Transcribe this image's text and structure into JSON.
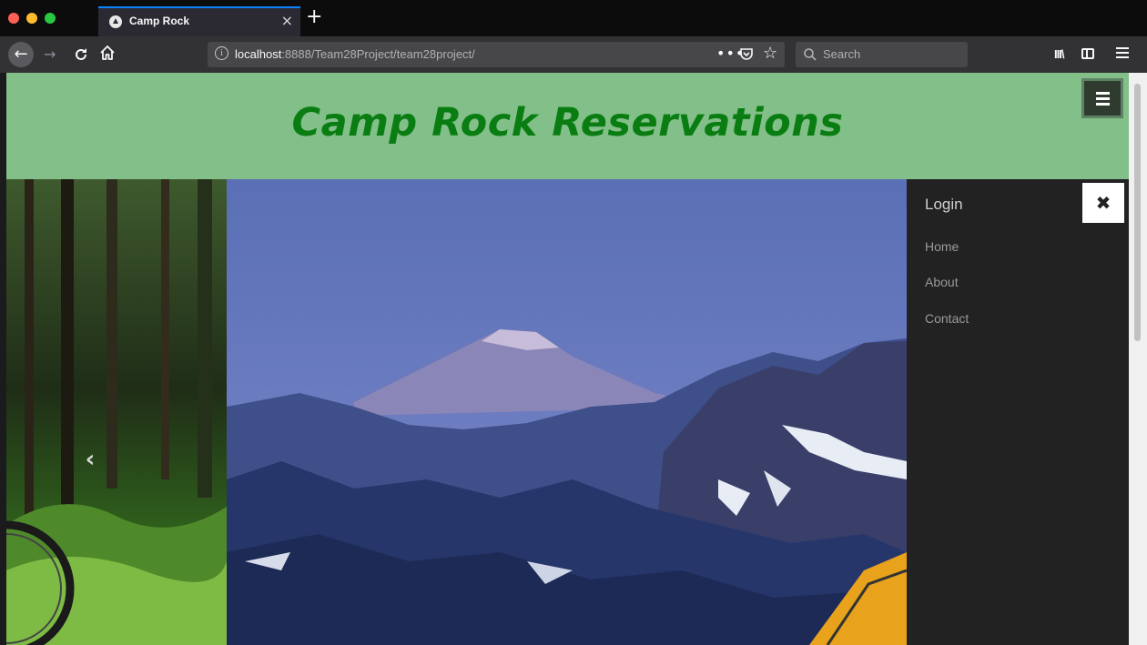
{
  "browser": {
    "tab": {
      "title": "Camp Rock",
      "close_glyph": "×"
    },
    "new_tab_glyph": "+",
    "nav": {
      "back_glyph": "←",
      "forward_glyph": "→",
      "reload_glyph": "C"
    },
    "url": {
      "host": "localhost",
      "rest": ":8888/Team28Project/team28project/",
      "more_glyph": "•••",
      "star_glyph": "☆"
    },
    "search": {
      "placeholder": "Search"
    },
    "library_glyph": "III\\"
  },
  "page": {
    "title": "Camp Rock Reservations",
    "carousel_prev_glyph": "‹",
    "side_menu": {
      "heading": "Login",
      "close_glyph": "✖",
      "links": [
        {
          "label": "Home"
        },
        {
          "label": "About"
        },
        {
          "label": "Contact"
        }
      ]
    }
  },
  "colors": {
    "header_bg": "#82bf89",
    "title_color": "#0a7d12",
    "side_menu_bg": "#222222"
  }
}
